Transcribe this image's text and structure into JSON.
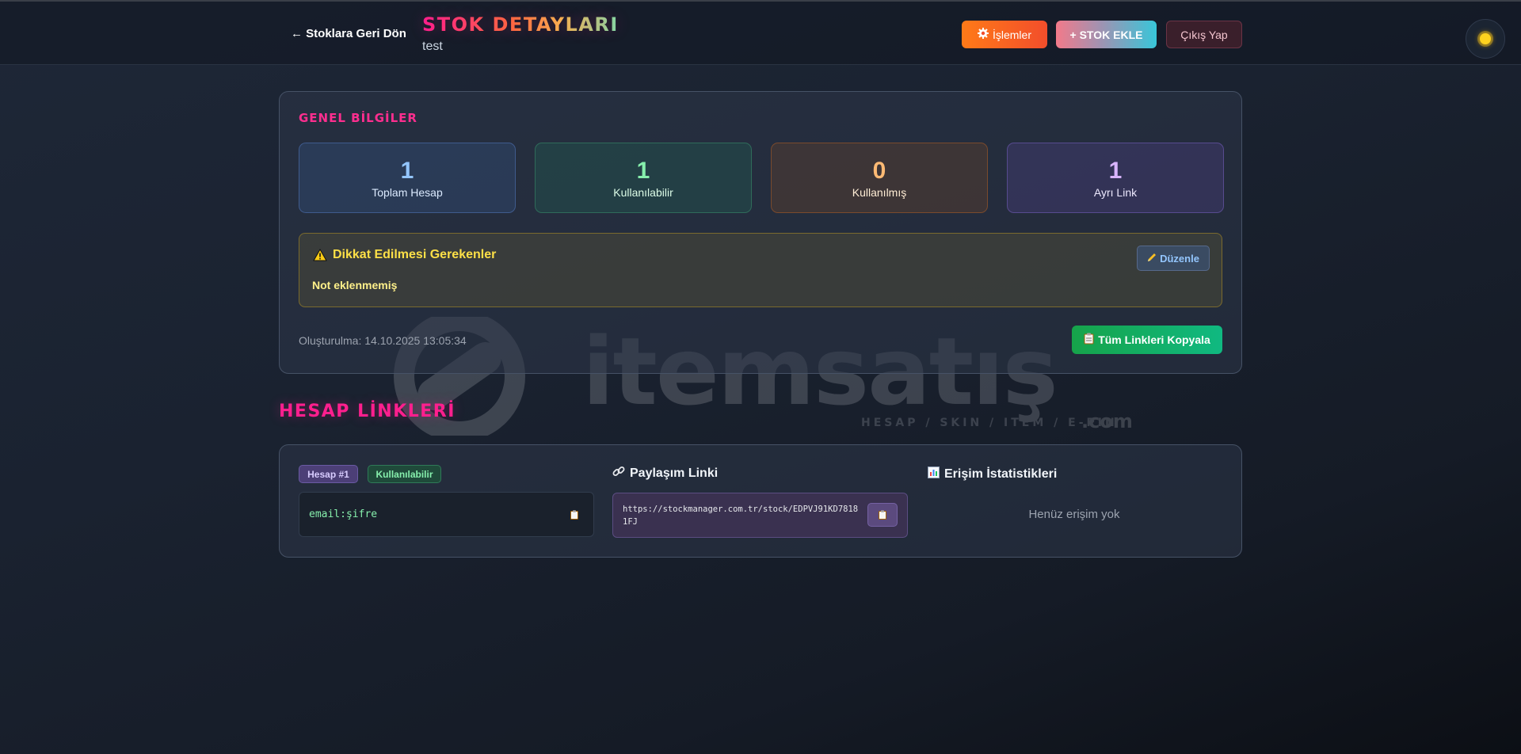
{
  "header": {
    "back_label": "← Stoklara Geri Dön",
    "title": "STOK DETAYLARI",
    "subtitle": "test",
    "ops_label": "İşlemler",
    "ops_icon": "gear-icon",
    "add_label": "+ STOK EKLE",
    "logout_label": "Çıkış Yap",
    "theme_icon": "sun-icon"
  },
  "general": {
    "title": "GENEL BİLGİLER",
    "stats": [
      {
        "value": "1",
        "label": "Toplam Hesap"
      },
      {
        "value": "1",
        "label": "Kullanılabilir"
      },
      {
        "value": "0",
        "label": "Kullanılmış"
      },
      {
        "value": "1",
        "label": "Ayrı Link"
      }
    ],
    "notes": {
      "title": "Dikkat Edilmesi Gerekenler",
      "text": "Not eklenmemiş",
      "edit_label": "Düzenle"
    },
    "created": "Oluşturulma: 14.10.2025 13:05:34",
    "copy_all_label": "Tüm Linkleri Kopyala"
  },
  "links_section": {
    "title": "HESAP LİNKLERİ",
    "items": [
      {
        "account_badge": "Hesap #1",
        "status_badge": "Kullanılabilir",
        "credentials": "email:şifre",
        "share_title": "Paylaşım Linki",
        "share_url": "https://stockmanager.com.tr/stock/EDPVJ91KD78181FJ",
        "stats_title": "Erişim İstatistikleri",
        "stats_empty": "Henüz erişim yok"
      }
    ]
  },
  "watermark": {
    "brand": "itemsatış",
    "tagline": "HESAP / SKIN / ITEM / E-PIN",
    "suffix": ".com"
  },
  "colors": {
    "accent_pink": "#ff1f8e",
    "success": "#16a34a",
    "warning": "#fde047"
  }
}
